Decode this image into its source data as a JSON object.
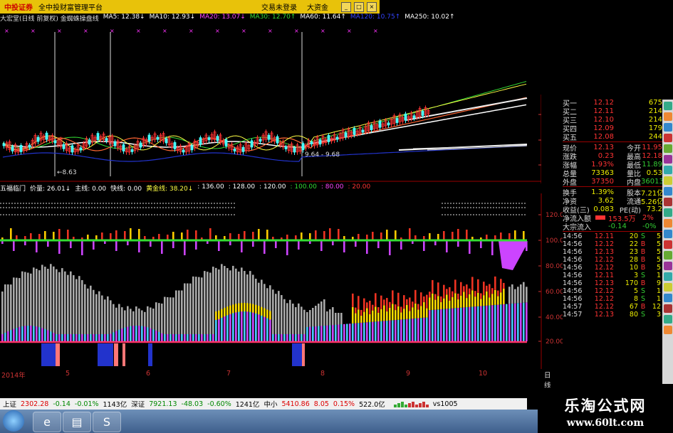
{
  "titlebar": {
    "logo": "中投证券",
    "platform": "全中投财富管理平台",
    "items": [
      "交易未登录",
      "大资金"
    ],
    "buttons": [
      "_",
      "□",
      "×"
    ]
  },
  "main_chart": {
    "header": "大宏堂(日线 前复权) 金蜘蛛操盘线",
    "ma": [
      {
        "label": "MA5: 12.38↓",
        "color": "#ffffff"
      },
      {
        "label": "MA10: 12.93↓",
        "color": "#ffffff"
      },
      {
        "label": "MA20: 13.07↓",
        "color": "#ff44ff"
      },
      {
        "label": "MA30: 12.70↑",
        "color": "#33dd33"
      },
      {
        "label": "MA60: 11.64↑",
        "color": "#ffffff"
      },
      {
        "label": "MA120: 10.75↑",
        "color": "#3344ff"
      },
      {
        "label": "MA250: 10.02↑",
        "color": "#ffffff"
      }
    ],
    "price_ticks": [
      "11.00",
      "10.00",
      "9.00"
    ],
    "annotations": [
      "←8.63",
      "9.64 - 9.68"
    ]
  },
  "indicator": {
    "header": [
      {
        "label": "五福临门",
        "color": "#ffffff"
      },
      {
        "label": "价量: 26.01↓",
        "color": "#ffffff"
      },
      {
        "label": "主线: 0.00",
        "color": "#ffffff"
      },
      {
        "label": "快线: 0.00",
        "color": "#ffffff"
      },
      {
        "label": "黄金线: 38.20↓",
        "color": "#ffff44"
      },
      {
        "label": ": 136.00",
        "color": "#ffffff"
      },
      {
        "label": ": 128.00",
        "color": "#ffffff"
      },
      {
        "label": ": 120.00",
        "color": "#ffffff"
      },
      {
        "label": ": 100.00",
        "color": "#33dd33"
      },
      {
        "label": ": 80.00",
        "color": "#ff44ff"
      },
      {
        "label": ": 20.00",
        "color": "#ff3333"
      }
    ],
    "axis_ticks": [
      "120.0",
      "100.0",
      "80.00",
      "60.00",
      "40.00",
      "20.00"
    ]
  },
  "date_axis": {
    "labels": [
      "2014年",
      "5",
      "6",
      "7",
      "8",
      "9",
      "10"
    ],
    "period": "日线"
  },
  "quote_panel": {
    "bids": [
      {
        "name": "买一",
        "price": "12.12",
        "vol": "675"
      },
      {
        "name": "买二",
        "price": "12.11",
        "vol": "214"
      },
      {
        "name": "买三",
        "price": "12.10",
        "vol": "214"
      },
      {
        "name": "买四",
        "price": "12.09",
        "vol": "179"
      },
      {
        "name": "买五",
        "price": "12.08",
        "vol": "244"
      }
    ],
    "stats": [
      {
        "k1": "现价",
        "v1": "12.13",
        "k2": "今开",
        "v2": "11.95"
      },
      {
        "k1": "涨跌",
        "v1": "0.23",
        "k2": "最高",
        "v2": "12.18"
      },
      {
        "k1": "涨幅",
        "v1": "1.93%",
        "k2": "最低",
        "v2": "11.89"
      },
      {
        "k1": "总量",
        "v1": "73363",
        "k2": "量比",
        "v2": "0.53"
      },
      {
        "k1": "外盘",
        "v1": "37350",
        "k2": "内盘",
        "v2": "36013"
      }
    ],
    "stats2": [
      {
        "k1": "换手",
        "v1": "1.39%",
        "k2": "股本",
        "v2": "7.21亿"
      },
      {
        "k1": "净资",
        "v1": "3.62",
        "k2": "流通",
        "v2": "5.26亿"
      },
      {
        "k1": "收益(三)",
        "v1": "0.083",
        "k2": "PE(动)",
        "v2": "73.2"
      }
    ],
    "net_inflow": {
      "label": "净流入额",
      "value": "153.5万",
      "pct": "2%"
    },
    "big_inflow": {
      "label": "大宗流入",
      "value": "-0.14",
      "pct": "-0%"
    },
    "ticks": [
      {
        "time": "14:56",
        "price": "12.11",
        "vol": "20",
        "side": "S",
        "n": "5"
      },
      {
        "time": "14:56",
        "price": "12.12",
        "vol": "22",
        "side": "B",
        "n": "5"
      },
      {
        "time": "14:56",
        "price": "12.13",
        "vol": "23",
        "side": "B",
        "n": "5"
      },
      {
        "time": "14:56",
        "price": "12.12",
        "vol": "28",
        "side": "B",
        "n": "5"
      },
      {
        "time": "14:56",
        "price": "12.12",
        "vol": "10",
        "side": "B",
        "n": "5"
      },
      {
        "time": "14:56",
        "price": "12.11",
        "vol": "3",
        "side": "S",
        "n": "1"
      },
      {
        "time": "14:56",
        "price": "12.13",
        "vol": "170",
        "side": "B",
        "n": "9"
      },
      {
        "time": "14:56",
        "price": "12.12",
        "vol": "5",
        "side": "S",
        "n": "1"
      },
      {
        "time": "14:56",
        "price": "12.12",
        "vol": "8",
        "side": "S",
        "n": "1"
      },
      {
        "time": "14:57",
        "price": "12.12",
        "vol": "67",
        "side": "B",
        "n": "12"
      },
      {
        "time": "14:57",
        "price": "12.13",
        "vol": "80",
        "side": "S",
        "n": "3"
      }
    ]
  },
  "statusbar": {
    "items": [
      {
        "text": "上证",
        "color": "#000"
      },
      {
        "text": "2302.28",
        "color": "#d00"
      },
      {
        "text": "-0.14",
        "color": "#080"
      },
      {
        "text": "-0.01%",
        "color": "#080"
      },
      {
        "text": "1143亿",
        "color": "#000"
      },
      {
        "text": "深证",
        "color": "#000"
      },
      {
        "text": "7921.13",
        "color": "#080"
      },
      {
        "text": "-48.03",
        "color": "#080"
      },
      {
        "text": "-0.60%",
        "color": "#080"
      },
      {
        "text": "1241亿",
        "color": "#000"
      },
      {
        "text": "中小",
        "color": "#000"
      },
      {
        "text": "5410.86",
        "color": "#d00"
      },
      {
        "text": "8.05",
        "color": "#d00"
      },
      {
        "text": "0.15%",
        "color": "#d00"
      },
      {
        "text": "522.0亿",
        "color": "#000"
      }
    ],
    "extra": "vs1005"
  },
  "watermark": {
    "title": "乐淘公式网",
    "url": "www.60lt.com"
  }
}
